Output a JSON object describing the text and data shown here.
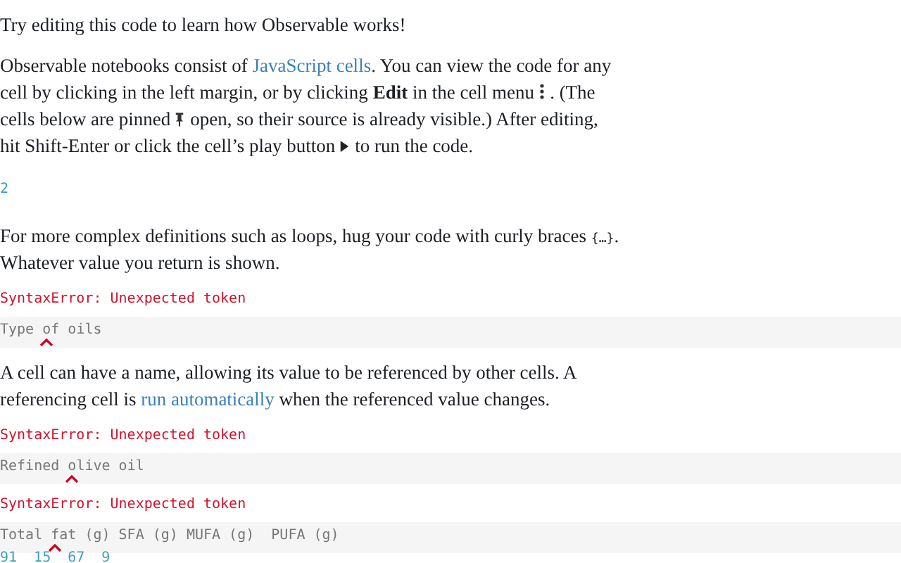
{
  "blocks": [
    {
      "kind": "paragraph",
      "parts": [
        {
          "kind": "text",
          "text": "Try editing this code to learn how Observable works!"
        }
      ]
    },
    {
      "kind": "paragraph",
      "parts": [
        {
          "kind": "text",
          "text": "Observable notebooks consist of "
        },
        {
          "kind": "link",
          "text": "JavaScript cells"
        },
        {
          "kind": "text",
          "text": ". You can view the code for any cell by clicking in the left margin, or by clicking **Edit** in the cell menu"
        },
        {
          "kind": "dots"
        },
        {
          "kind": "text",
          "text": ". (The cells below are pinned"
        },
        {
          "kind": "pin"
        },
        {
          "kind": "text",
          "text": "open, so their source is already visible.) After editing, hit Shift-Enter or click the cell’s play button"
        },
        {
          "kind": "play"
        },
        {
          "kind": "text",
          "text": "to run the code."
        }
      ]
    },
    {
      "kind": "value",
      "text": "2"
    },
    {
      "kind": "paragraph",
      "parts": [
        {
          "kind": "text",
          "text": "For more complex definitions such as loops, hug your code with curly braces "
        },
        {
          "kind": "code",
          "text": "{…}"
        },
        {
          "kind": "text",
          "text": ". Whatever value you return is shown."
        }
      ]
    },
    {
      "kind": "error",
      "message": "SyntaxError: Unexpected token",
      "source": [
        "Type ",
        "of oils"
      ]
    },
    {
      "kind": "paragraph",
      "parts": [
        {
          "kind": "text",
          "text": "A cell can have a name, allowing its value to be referenced by other cells. A referencing cell is "
        },
        {
          "kind": "link",
          "text": "run automatically"
        },
        {
          "kind": "text",
          "text": " when the referenced value changes."
        }
      ]
    },
    {
      "kind": "error",
      "message": "SyntaxError: Unexpected token",
      "source": [
        "Refined ",
        "olive oil"
      ]
    },
    {
      "kind": "error",
      "message": "SyntaxError: Unexpected token",
      "source": [
        "Total ",
        "fat (g) SFA (g) MUFA (g)  PUFA (g)"
      ],
      "values": [
        "91",
        "15",
        "67",
        "9"
      ]
    }
  ]
}
